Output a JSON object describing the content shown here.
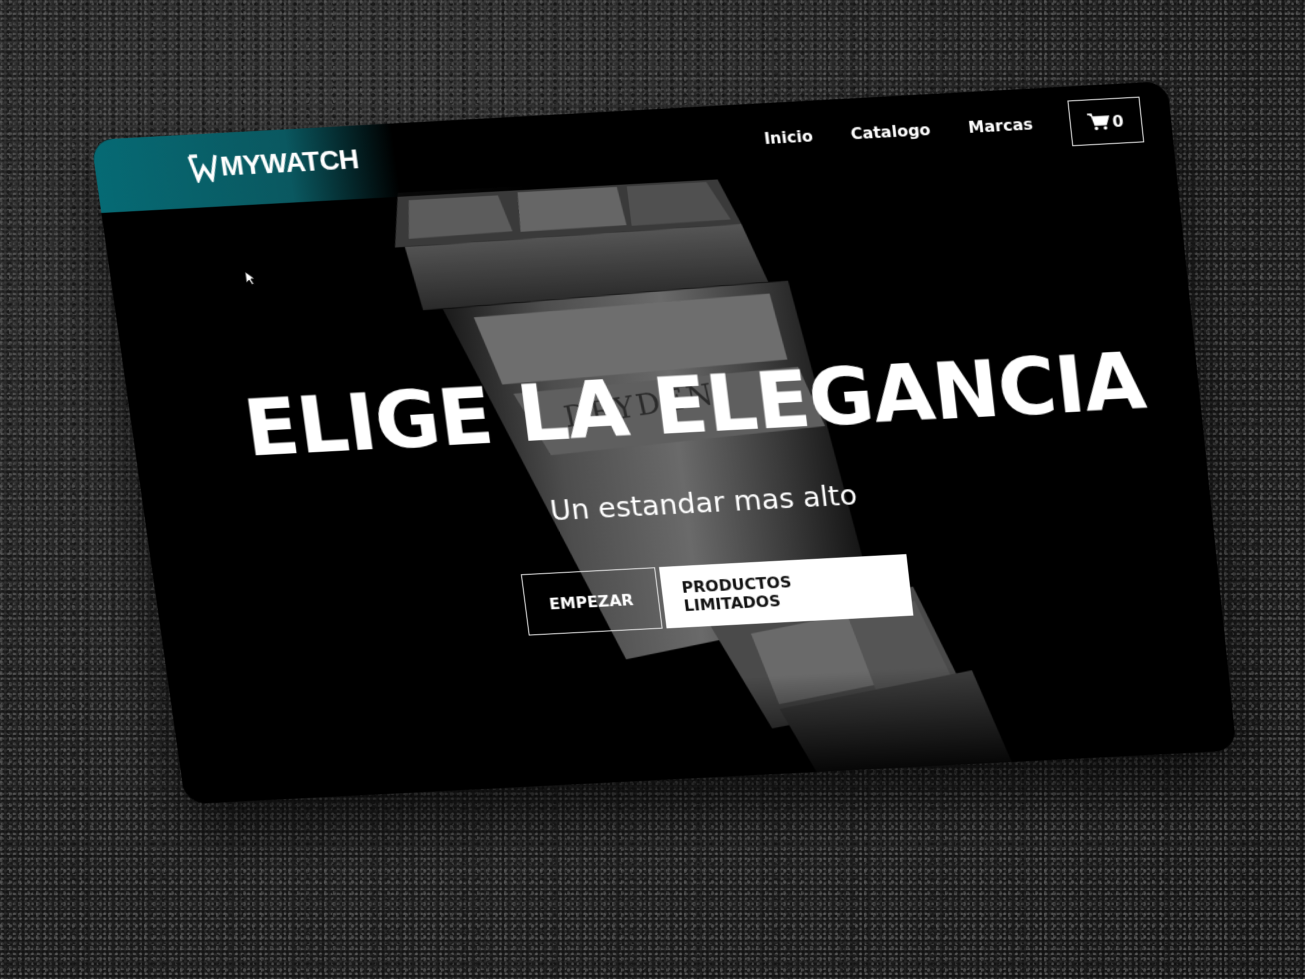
{
  "brand": {
    "name": "MYWATCH",
    "logo_icon": "w-logo-icon"
  },
  "nav": {
    "links": [
      "Inicio",
      "Catalogo",
      "Marcas"
    ],
    "cart_count": "0",
    "cart_icon": "cart-icon"
  },
  "hero": {
    "title": "ELIGE LA ELEGANCIA",
    "subtitle": "Un estandar mas alto",
    "primary_button": "EMPEZAR",
    "secondary_button": "PRODUCTOS LIMITADOS",
    "engraving": "DRYDEN"
  },
  "colors": {
    "accent": "#066a74",
    "background": "#000000",
    "text": "#ffffff"
  }
}
